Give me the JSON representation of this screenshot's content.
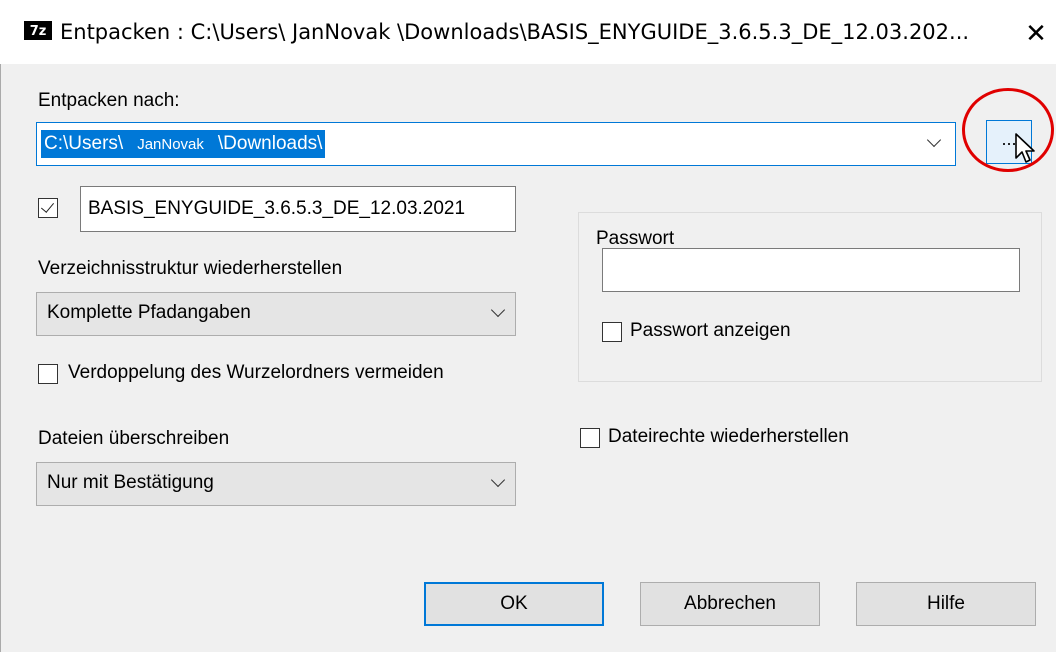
{
  "window": {
    "app_icon_label": "7z",
    "title": "Entpacken : C:\\Users\\    JanNovak      \\Downloads\\BASIS_ENYGUIDE_3.6.5.3_DE_12.03.202...",
    "close_symbol": "✕"
  },
  "extract_to": {
    "label": "Entpacken nach:",
    "path_prefix": "C:\\Users\\",
    "path_user": "JanNovak",
    "path_suffix": "\\Downloads\\",
    "browse_label": "..."
  },
  "subfolder": {
    "checked": true,
    "value": "BASIS_ENYGUIDE_3.6.5.3_DE_12.03.2021"
  },
  "path_mode": {
    "label": "Verzeichnisstruktur wiederherstellen",
    "selected": "Komplette Pfadangaben"
  },
  "avoid_duplicate_root": {
    "label": "Verdoppelung des Wurzelordners vermeiden",
    "checked": false
  },
  "overwrite": {
    "label": "Dateien überschreiben",
    "selected": "Nur mit Bestätigung"
  },
  "password": {
    "group_title": "Passwort",
    "value": "",
    "show_label": "Passwort anzeigen",
    "show_checked": false
  },
  "restore_permissions": {
    "label": "Dateirechte wiederherstellen",
    "checked": false
  },
  "buttons": {
    "ok": "OK",
    "cancel": "Abbrechen",
    "help": "Hilfe"
  },
  "colors": {
    "accent": "#0078d7",
    "highlight_circle": "#e00000"
  }
}
